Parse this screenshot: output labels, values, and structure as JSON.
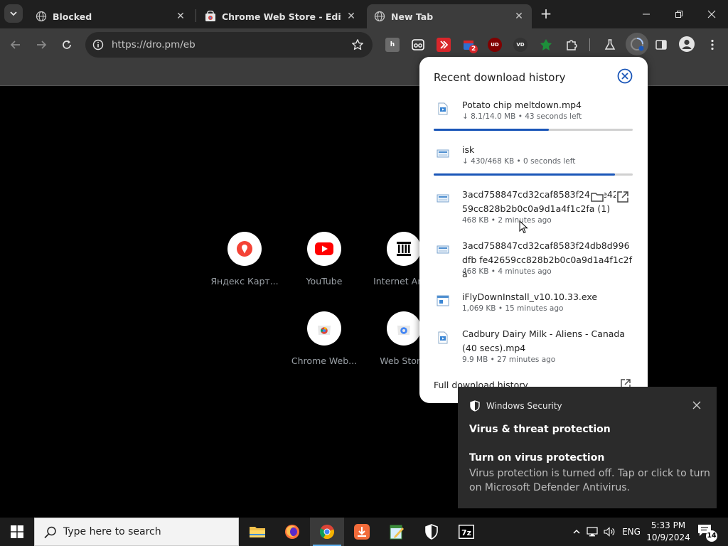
{
  "tabs": [
    {
      "title": "Blocked",
      "icon": "globe-icon",
      "active": false
    },
    {
      "title": "Chrome Web Store - Editors' Picks",
      "icon": "web-store-icon",
      "active": false
    },
    {
      "title": "New Tab",
      "icon": "globe-icon",
      "active": true
    }
  ],
  "omnibox": {
    "url": "https://dro.pm/eb"
  },
  "extensions": [
    {
      "name": "h-extension-icon",
      "text": "h",
      "color": "#6b6b6b"
    },
    {
      "name": "glasses-extension-icon",
      "text": "",
      "color": "#3c3c3c"
    },
    {
      "name": "red-extension-icon",
      "text": "",
      "color": "#d9262b"
    },
    {
      "name": "calendar-extension-icon",
      "text": "",
      "color": "#2f6fd1",
      "badge": "2"
    },
    {
      "name": "ublock-extension-icon",
      "text": "UD",
      "color": "#800000"
    },
    {
      "name": "vd-extension-icon",
      "text": "VD",
      "color": "#333333"
    },
    {
      "name": "green-extension-icon",
      "text": "",
      "color": "#1d8f3a"
    }
  ],
  "shortcuts": [
    {
      "label": "Яндекс Карт...",
      "icon": "map-pin-icon"
    },
    {
      "label": "YouTube",
      "icon": "youtube-icon"
    },
    {
      "label": "Internet Arc...",
      "icon": "archive-icon"
    },
    {
      "label": "Chrome Web...",
      "icon": "chrome-web-store-icon"
    },
    {
      "label": "Web Stor...",
      "icon": "web-store-icon"
    }
  ],
  "downloads": {
    "title": "Recent download history",
    "items": [
      {
        "name": "Potato chip meltdown.mp4",
        "meta": "↓ 8.1/14.0 MB • 43 seconds left",
        "progress": 0.58,
        "icon": "video-file-icon"
      },
      {
        "name": "isk",
        "meta": "↓ 430/468 KB • 0 seconds left",
        "progress": 0.91,
        "icon": "generic-file-icon"
      },
      {
        "name": "3acd758847cd32caf8583f24d fe42659cc828b2b0c0a9d1a4f1c2fa (1)",
        "meta": "468 KB • 2 minutes ago",
        "icon": "generic-file-icon"
      },
      {
        "name": "3acd758847cd32caf8583f24db8d996dfb fe42659cc828b2b0c0a9d1a4f1c2fa",
        "meta": "468 KB • 4 minutes ago",
        "icon": "generic-file-icon"
      },
      {
        "name": "iFlyDownInstall_v10.10.33.exe",
        "meta": "1,069 KB • 15 minutes ago",
        "icon": "exe-file-icon"
      },
      {
        "name": "Cadbury Dairy Milk - Aliens - Canada (40 secs).mp4",
        "meta": "9.9 MB • 27 minutes ago",
        "icon": "video-file-icon"
      }
    ],
    "full_history": "Full download history"
  },
  "toast": {
    "app_name": "Windows Security",
    "heading": "Virus & threat protection",
    "subheading": "Turn on virus protection",
    "body": "Virus protection is turned off. Tap or click to turn on Microsoft Defender Antivirus."
  },
  "taskbar": {
    "search_placeholder": "Type here to search",
    "language": "ENG",
    "time": "5:33 PM",
    "date": "10/9/2024",
    "notification_count": "14"
  },
  "colors": {
    "accent": "#1a56b8",
    "tab_bg": "#1f1f1f",
    "toolbar_bg": "#3c3c3c"
  }
}
